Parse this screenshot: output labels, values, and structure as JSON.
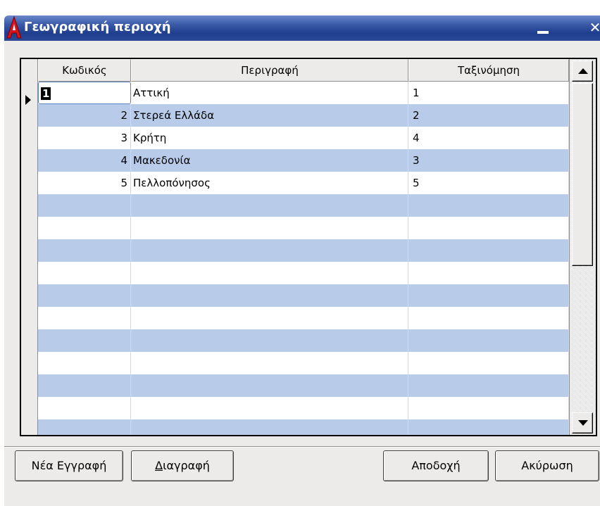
{
  "window": {
    "title": "Γεωγραφική περιοχή",
    "logo_letter": "A"
  },
  "grid": {
    "columns": [
      "Κωδικός",
      "Περιγραφή",
      "Ταξινόμηση"
    ],
    "rows": [
      {
        "code": "1",
        "description": "Αττική",
        "sort": "1"
      },
      {
        "code": "2",
        "description": "Στερεά Ελλάδα",
        "sort": "2"
      },
      {
        "code": "3",
        "description": "Κρήτη",
        "sort": "4"
      },
      {
        "code": "4",
        "description": "Μακεδονία",
        "sort": "3"
      },
      {
        "code": "5",
        "description": "Πελλοπόνησος",
        "sort": "5"
      }
    ]
  },
  "buttons": {
    "new_record": "Νέα Εγγραφή",
    "delete_first": "Δ",
    "delete_rest": "ιαγραφή",
    "accept": "Αποδοχή",
    "cancel": "Ακύρωση"
  },
  "colors": {
    "title_bar": "#1f3f8e",
    "row_stripe": "#b8cbe9",
    "logo_red": "#d8141c"
  }
}
